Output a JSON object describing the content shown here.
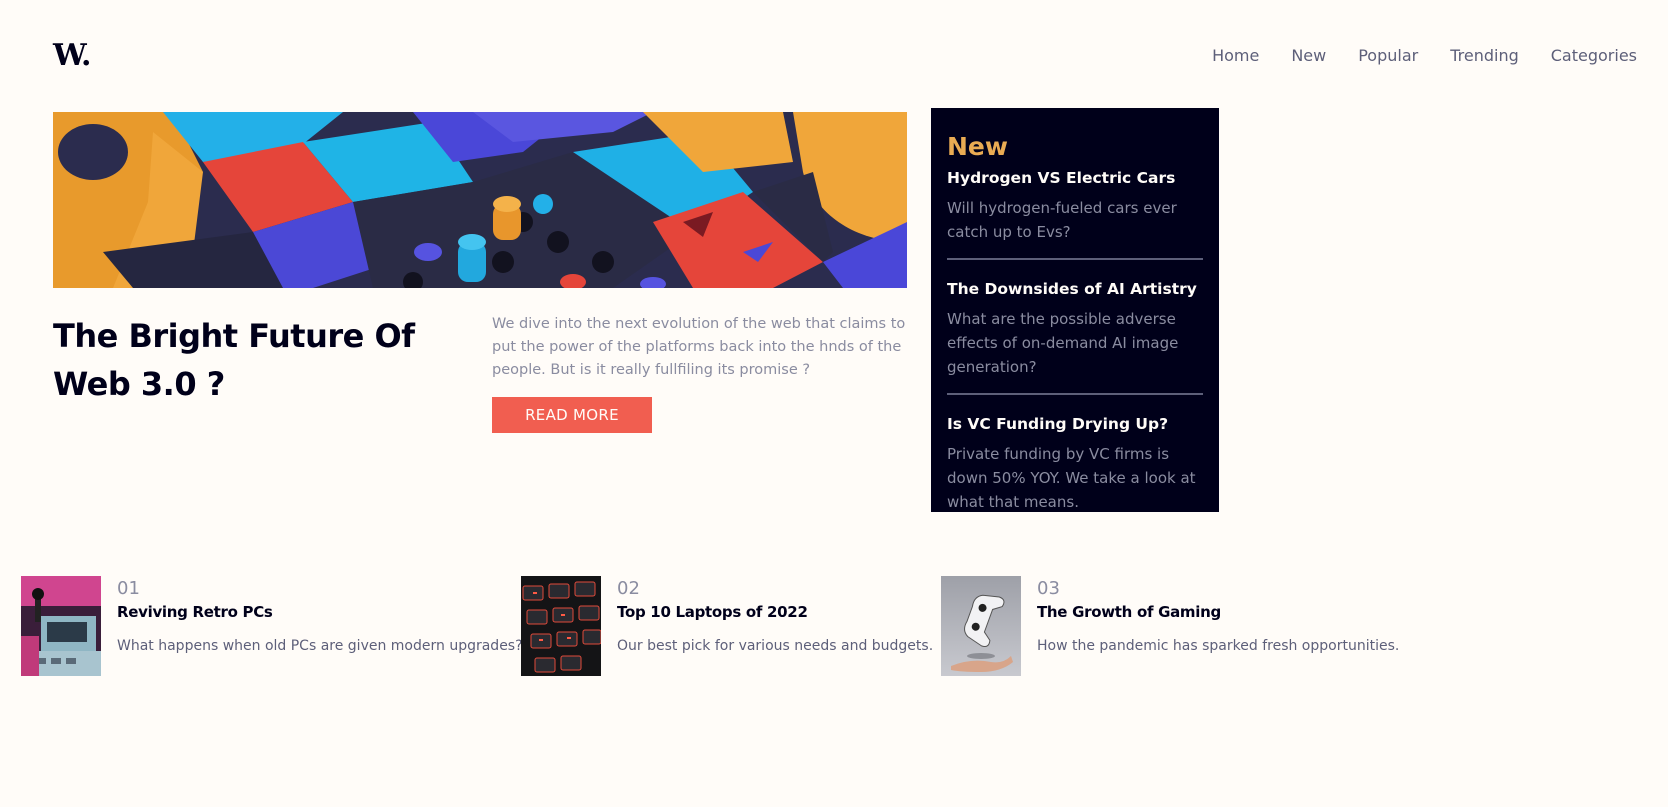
{
  "brand": {
    "logo": "W."
  },
  "nav": [
    "Home",
    "New",
    "Popular",
    "Trending",
    "Categories"
  ],
  "hero": {
    "title": "The Bright Future Of Web 3.0 ?",
    "description": "We dive into the next evolution of the web that claims to put the power of the platforms back into the hnds of the people. But is it really fullfiling its promise ?",
    "button_label": "READ MORE"
  },
  "new_section": {
    "heading": "New",
    "items": [
      {
        "title": "Hydrogen VS Electric Cars",
        "description": "Will hydrogen-fueled cars ever catch up to Evs?"
      },
      {
        "title": "The Downsides of AI Artistry",
        "description": "What are the possible adverse effects of on-demand AI image generation?"
      },
      {
        "title": "Is VC Funding Drying Up?",
        "description": "Private funding by VC firms is down 50% YOY. We take a look at what that means."
      }
    ]
  },
  "cards": [
    {
      "number": "01",
      "title": "Reviving Retro PCs",
      "description": "What happens when old PCs are given modern upgrades?"
    },
    {
      "number": "02",
      "title": "Top 10 Laptops of 2022",
      "description": "Our best pick for various needs and budgets."
    },
    {
      "number": "03",
      "title": "The Growth of Gaming",
      "description": "How the pandemic has sparked fresh opportunities."
    }
  ],
  "colors": {
    "background": "#fffcf8",
    "dark_navy": "#00001a",
    "accent_red": "#f15e50",
    "accent_orange": "#e9ab53",
    "grayish_blue": "#5d5f79",
    "gray": "#8a8ca0"
  }
}
